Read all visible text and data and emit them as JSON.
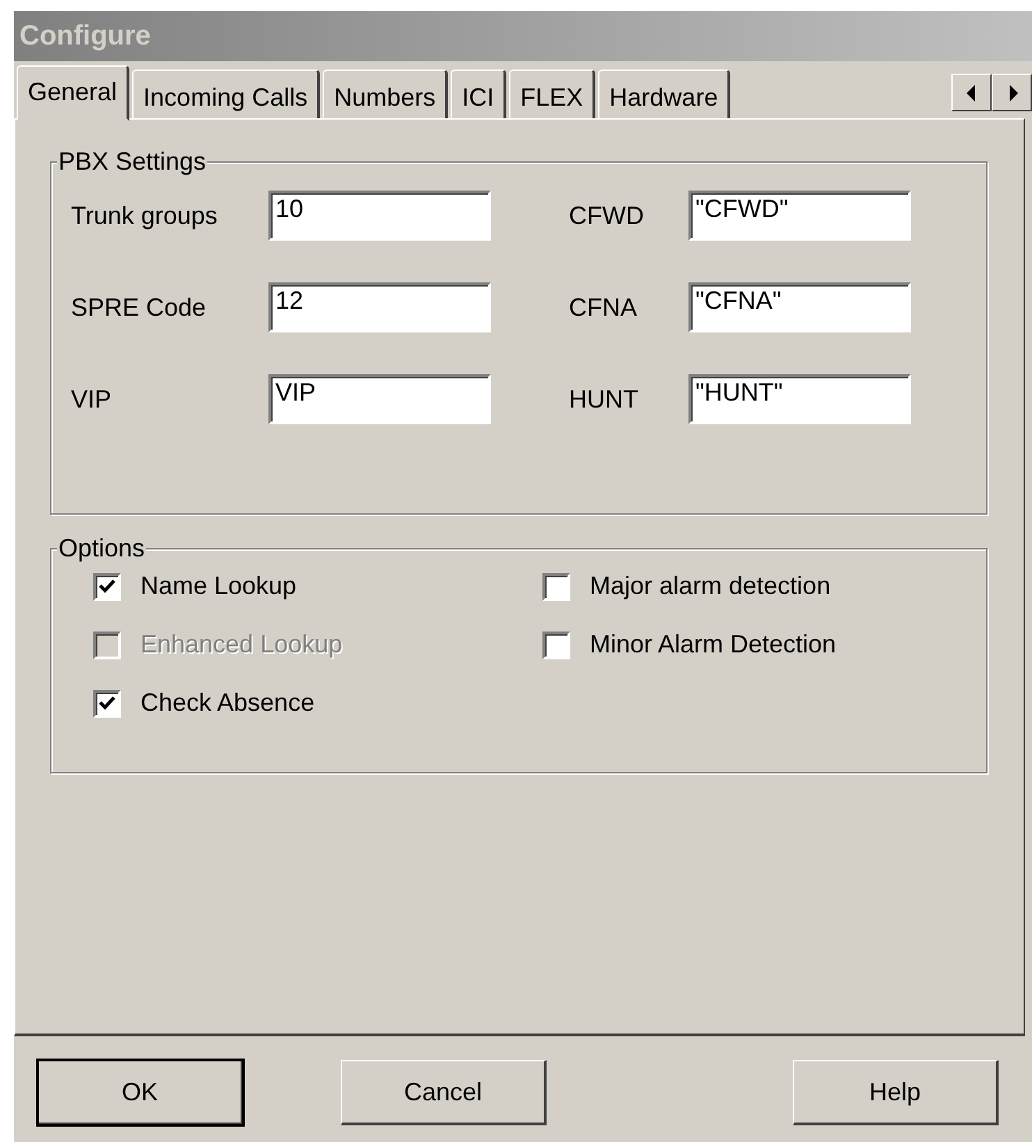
{
  "window": {
    "title": "Configure"
  },
  "tabs": [
    {
      "label": "General",
      "selected": true
    },
    {
      "label": "Incoming Calls",
      "selected": false
    },
    {
      "label": "Numbers",
      "selected": false
    },
    {
      "label": "ICI",
      "selected": false
    },
    {
      "label": "FLEX",
      "selected": false
    },
    {
      "label": "Hardware",
      "selected": false
    }
  ],
  "pbx_settings": {
    "title": "PBX Settings",
    "fields": [
      {
        "label": "Trunk groups",
        "value": "10"
      },
      {
        "label": "CFWD",
        "value": "\"CFWD\""
      },
      {
        "label": "SPRE Code",
        "value": "12"
      },
      {
        "label": "CFNA",
        "value": "\"CFNA\""
      },
      {
        "label": "VIP",
        "value": "VIP"
      },
      {
        "label": "HUNT",
        "value": "\"HUNT\""
      }
    ]
  },
  "options": {
    "title": "Options",
    "items": [
      {
        "label": "Name Lookup",
        "checked": true,
        "disabled": false
      },
      {
        "label": "Major alarm detection",
        "checked": false,
        "disabled": false
      },
      {
        "label": "Enhanced Lookup",
        "checked": false,
        "disabled": true
      },
      {
        "label": "Minor Alarm Detection",
        "checked": false,
        "disabled": false
      },
      {
        "label": "Check Absence",
        "checked": true,
        "disabled": false
      }
    ]
  },
  "buttons": [
    {
      "label": "OK",
      "default": true
    },
    {
      "label": "Cancel",
      "default": false
    },
    {
      "label": "Help",
      "default": false
    }
  ]
}
